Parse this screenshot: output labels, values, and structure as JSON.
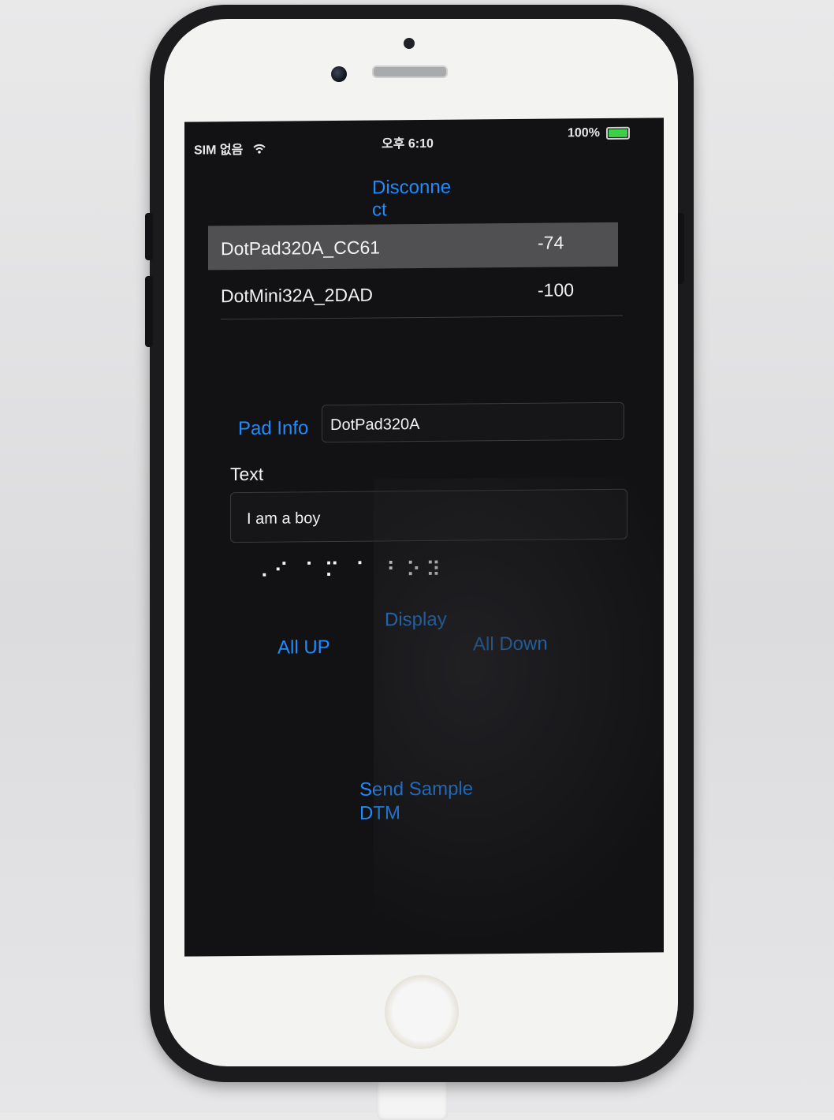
{
  "status_bar": {
    "carrier": "SIM 없음",
    "time": "오후 6:10",
    "battery": "100%"
  },
  "buttons": {
    "disconnect": "Disconne ct",
    "display": "Display",
    "all_up": "All UP",
    "all_down": "All Down",
    "send_sample_dtm": "Send Sample DTM"
  },
  "devices": [
    {
      "name": "DotPad320A_CC61",
      "rssi": "-74",
      "selected": true
    },
    {
      "name": "DotMini32A_2DAD",
      "rssi": "-100",
      "selected": false
    }
  ],
  "pad_info": {
    "label": "Pad Info",
    "value": "DotPad320A"
  },
  "text_section": {
    "label": "Text",
    "value": "I am a boy",
    "braille": "⠠⠊ ⠁⠍ ⠁ ⠃⠕⠽"
  },
  "colors": {
    "accent": "#1e8bff",
    "screen_background": "#121214",
    "selected_row": "#505053",
    "battery": "#3ecf4a"
  }
}
